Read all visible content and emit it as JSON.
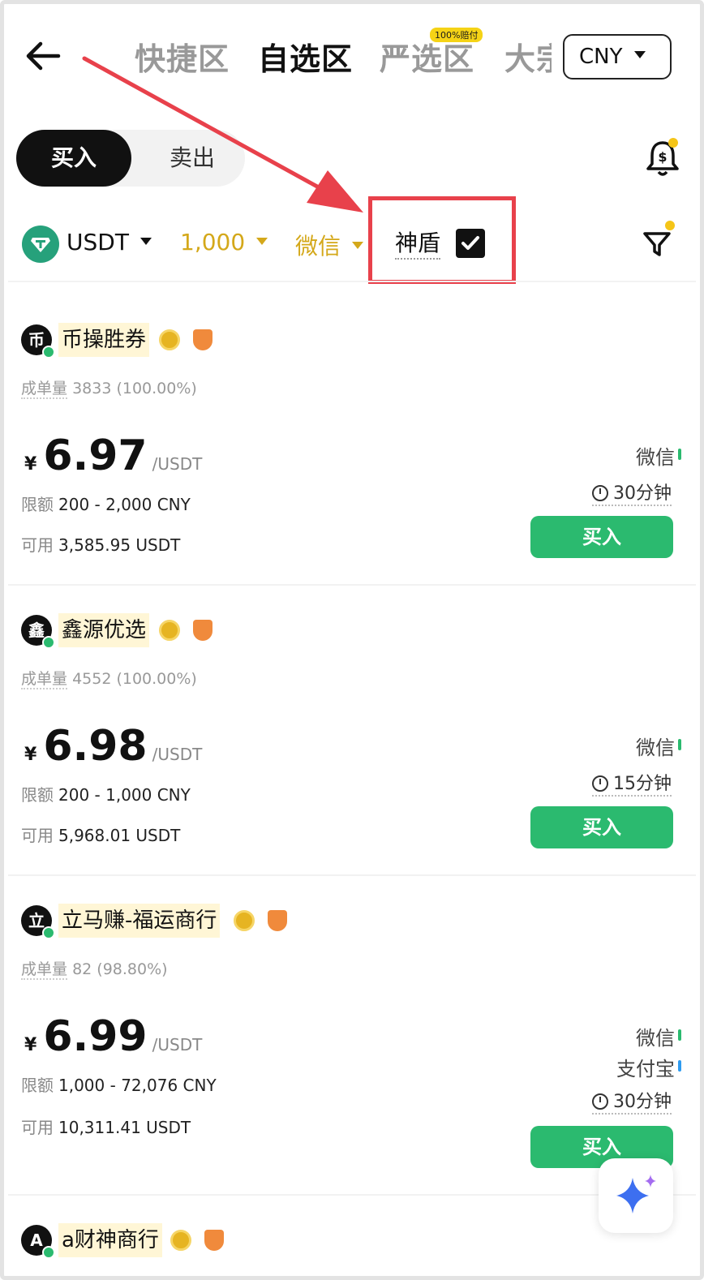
{
  "nav": {
    "tabs": [
      "快捷区",
      "自选区",
      "严选区",
      "大宗"
    ],
    "active_tab": "自选区",
    "badge": "100%赔付",
    "currency": "CNY"
  },
  "trade_toggle": {
    "buy": "买入",
    "sell": "卖出"
  },
  "filters": {
    "coin": "USDT",
    "amount": "1,000",
    "payment": "微信",
    "shield": "神盾"
  },
  "labels": {
    "orders": "成单量",
    "limit": "限额",
    "available": "可用",
    "currency_symbol": "¥",
    "unit": "/USDT",
    "buy_button": "买入"
  },
  "ads": [
    {
      "avatar": "币",
      "name": "币操胜券",
      "orders": "3833 (100.00%)",
      "price": "6.97",
      "limit": "200 - 2,000 CNY",
      "available": "3,585.95 USDT",
      "payments": [
        "微信"
      ],
      "time": "30分钟"
    },
    {
      "avatar": "鑫",
      "name": "鑫源优选",
      "orders": "4552 (100.00%)",
      "price": "6.98",
      "limit": "200 - 1,000 CNY",
      "available": "5,968.01 USDT",
      "payments": [
        "微信"
      ],
      "time": "15分钟"
    },
    {
      "avatar": "立",
      "name": "立马赚-福运商行",
      "orders": "82 (98.80%)",
      "price": "6.99",
      "limit": "1,000 - 72,076 CNY",
      "available": "10,311.41 USDT",
      "payments": [
        "微信",
        "支付宝"
      ],
      "time": "30分钟"
    },
    {
      "avatar": "A",
      "name": "a财神商行"
    }
  ],
  "colors": {
    "accent_green": "#2bba6f",
    "gold": "#d4a81a",
    "annotation_red": "#e8414b"
  }
}
